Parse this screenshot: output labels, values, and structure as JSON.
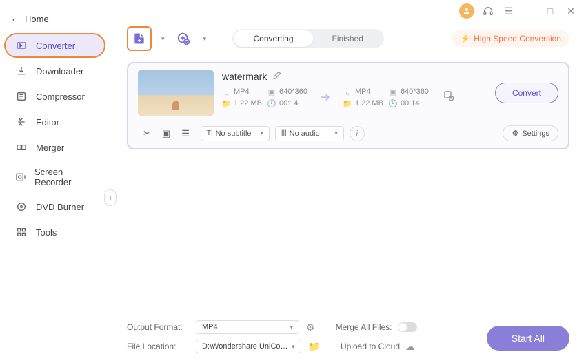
{
  "sidebar": {
    "home": "Home",
    "items": [
      {
        "label": "Converter"
      },
      {
        "label": "Downloader"
      },
      {
        "label": "Compressor"
      },
      {
        "label": "Editor"
      },
      {
        "label": "Merger"
      },
      {
        "label": "Screen Recorder"
      },
      {
        "label": "DVD Burner"
      },
      {
        "label": "Tools"
      }
    ]
  },
  "toolbar": {
    "tabs": {
      "converting": "Converting",
      "finished": "Finished"
    },
    "speed": "High Speed Conversion"
  },
  "card": {
    "title": "watermark",
    "source": {
      "format": "MP4",
      "resolution": "640*360",
      "size": "1.22 MB",
      "duration": "00:14"
    },
    "target": {
      "format": "MP4",
      "resolution": "640*360",
      "size": "1.22 MB",
      "duration": "00:14"
    },
    "convert_btn": "Convert",
    "subtitle_select": "No subtitle",
    "audio_select": "No audio",
    "settings_link": "Settings"
  },
  "footer": {
    "output_format_label": "Output Format:",
    "output_format_value": "MP4",
    "file_location_label": "File Location:",
    "file_location_value": "D:\\Wondershare UniConverter 1",
    "merge_label": "Merge All Files:",
    "upload_label": "Upload to Cloud",
    "start_all": "Start All"
  }
}
